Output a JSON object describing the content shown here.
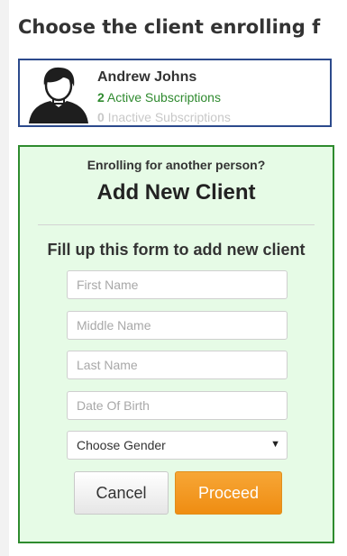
{
  "page": {
    "heading": "Choose the client enrolling f"
  },
  "client": {
    "name": "Andrew Johns",
    "active_count": "2",
    "active_label": " Active Subscriptions",
    "inactive_count": "0",
    "inactive_label": " Inactive Subscriptions",
    "avatar_icon": "user-silhouette-icon"
  },
  "new_client": {
    "question": "Enrolling for another person?",
    "title": "Add New Client",
    "form_title": "Fill up this form to add new client",
    "fields": {
      "first_name_placeholder": "First Name",
      "middle_name_placeholder": "Middle Name",
      "last_name_placeholder": "Last Name",
      "dob_placeholder": "Date Of Birth"
    },
    "gender_select": {
      "selected": "Choose Gender",
      "caret_icon": "chevron-down-icon"
    },
    "cancel_label": "Cancel",
    "proceed_label": "Proceed"
  },
  "colors": {
    "client_card_border": "#2c4a8c",
    "panel_border": "#2e8b2e",
    "panel_background": "#e6fbe6",
    "active_text": "#2f8a2f",
    "inactive_text": "#c8c8c8",
    "proceed_button": "#f39c1f"
  }
}
